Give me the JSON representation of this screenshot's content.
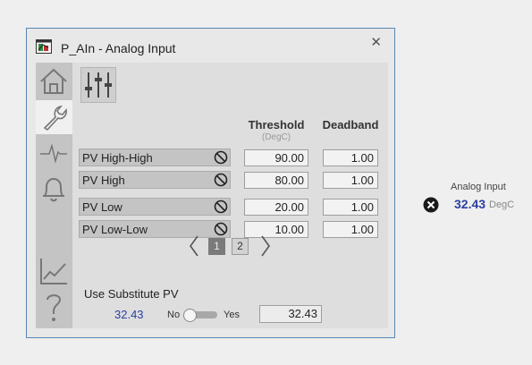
{
  "faceplate": {
    "title": "P_AIn - Analog Input",
    "close_glyph": "✕"
  },
  "sidebar": {
    "items": [
      {
        "icon": "home-icon",
        "active": false
      },
      {
        "icon": "wrench-icon",
        "active": true
      },
      {
        "icon": "trend-pulse-icon",
        "active": false
      },
      {
        "icon": "bell-icon",
        "active": false
      },
      {
        "icon": "chart-icon",
        "active": false
      },
      {
        "icon": "help-icon",
        "active": false
      }
    ]
  },
  "table": {
    "threshold_header": "Threshold",
    "threshold_units": "(DegC)",
    "deadband_header": "Deadband",
    "rows": [
      {
        "label": "PV High-High",
        "threshold": "90.00",
        "deadband": "1.00"
      },
      {
        "label": "PV High",
        "threshold": "80.00",
        "deadband": "1.00"
      },
      {
        "label": "PV Low",
        "threshold": "20.00",
        "deadband": "1.00"
      },
      {
        "label": "PV Low-Low",
        "threshold": "10.00",
        "deadband": "1.00"
      }
    ]
  },
  "pager": {
    "pages": [
      "1",
      "2"
    ],
    "current": "1"
  },
  "substitute": {
    "label": "Use Substitute PV",
    "pv_value": "32.43",
    "no_label": "No",
    "yes_label": "Yes",
    "enabled": false,
    "input_value": "32.43"
  },
  "external": {
    "label": "Analog Input",
    "value": "32.43",
    "unit": "DegC"
  },
  "colors": {
    "accent_value": "#2a3fa0",
    "frame_border": "#5a86b4"
  }
}
